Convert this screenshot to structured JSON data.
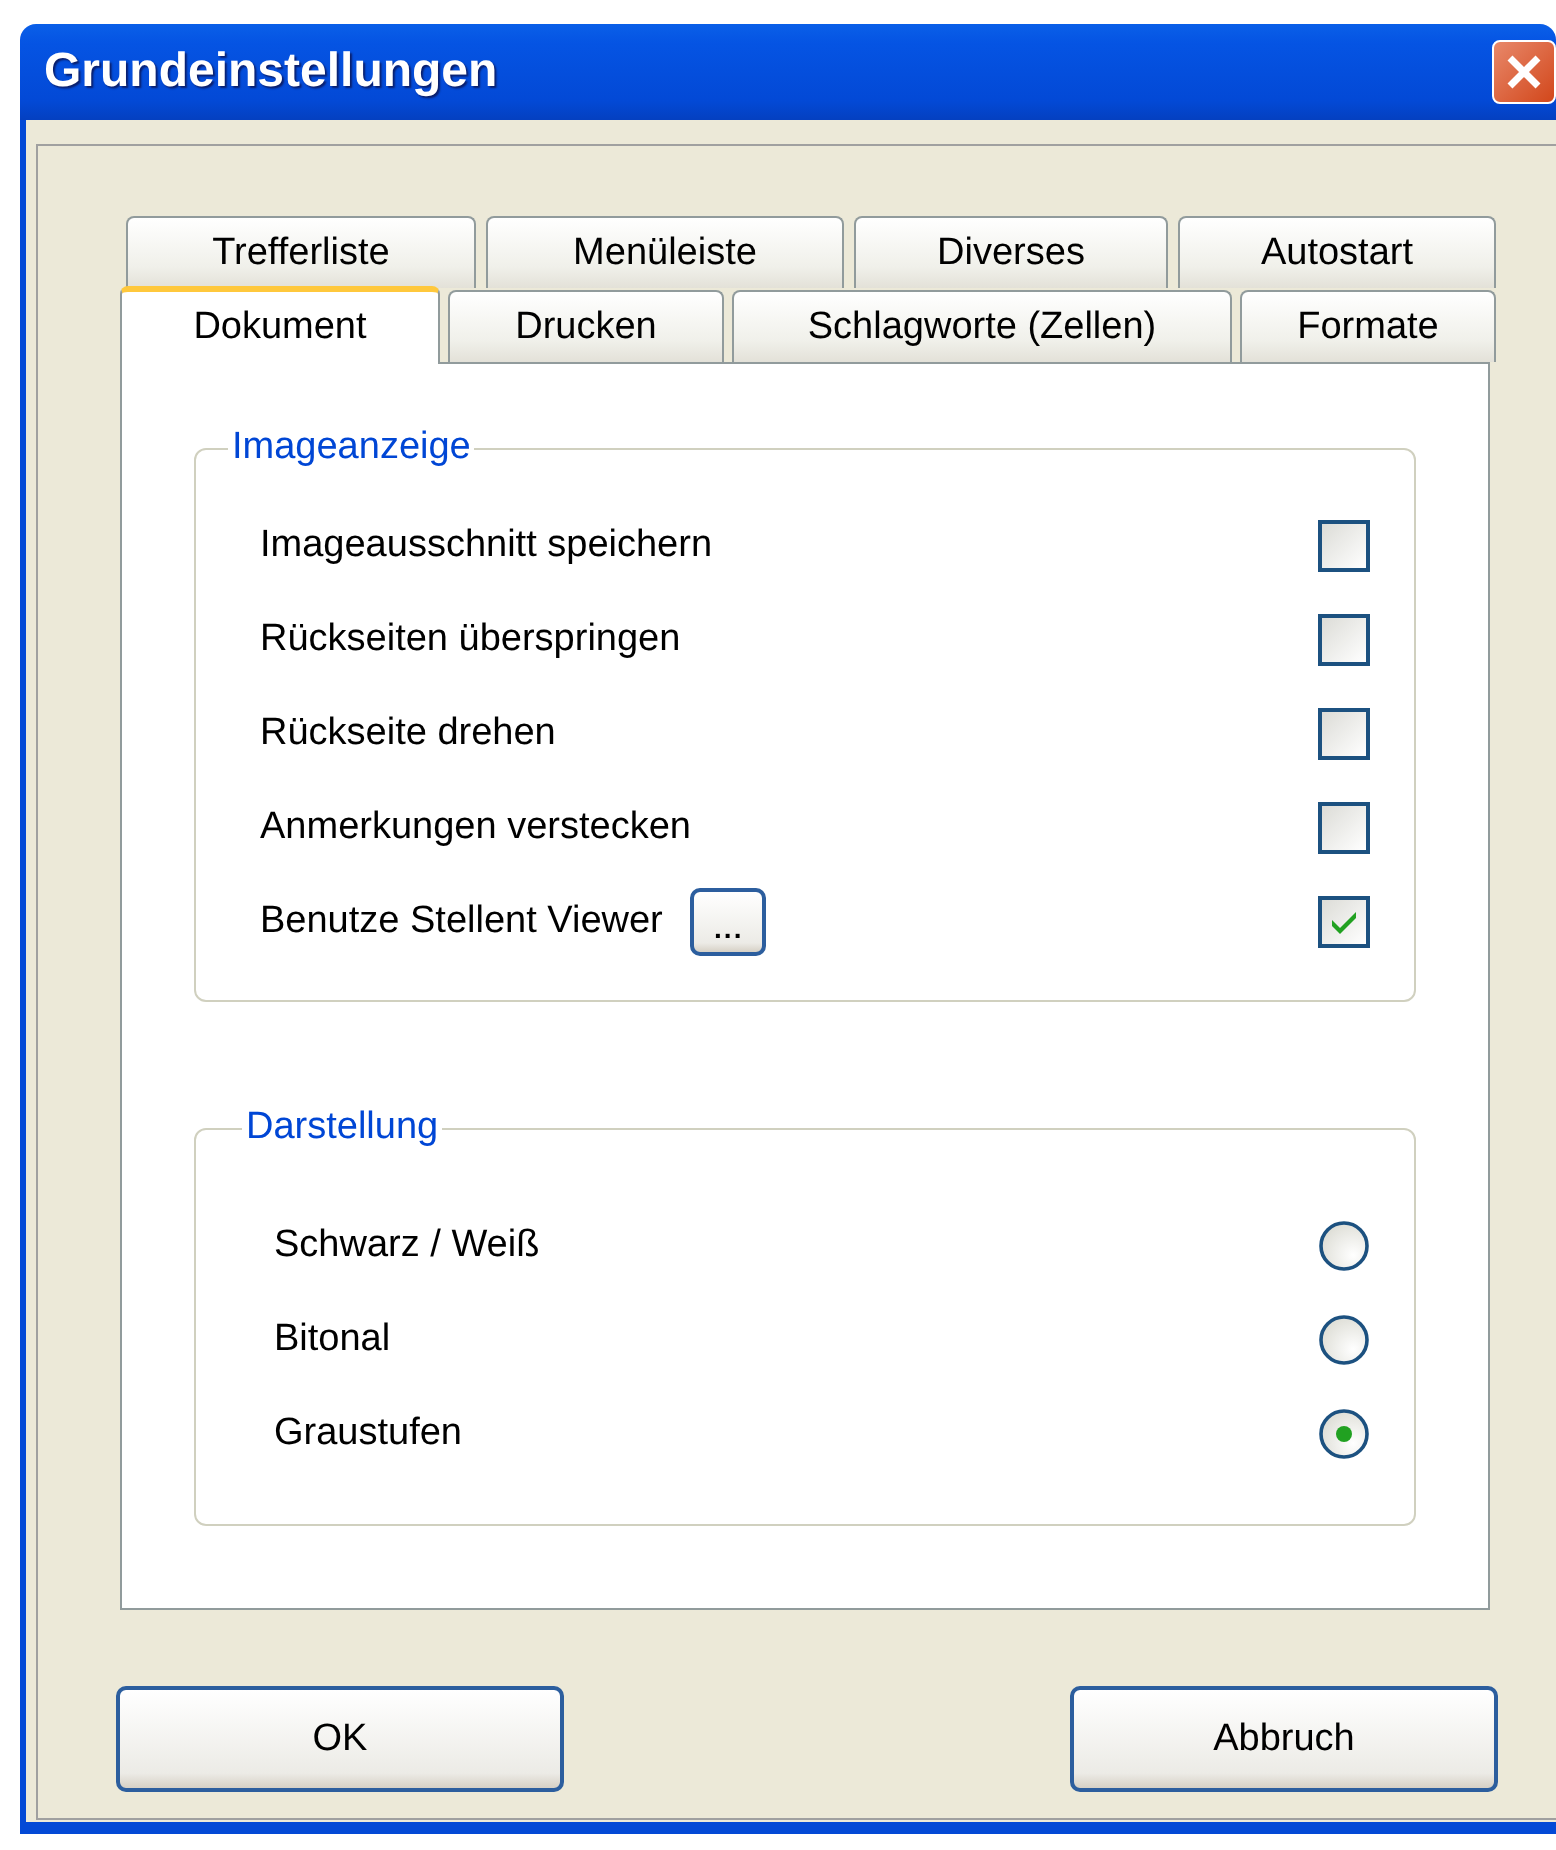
{
  "window": {
    "title": "Grundeinstellungen"
  },
  "tab_rows": [
    [
      {
        "label": "Trefferliste",
        "selected": false
      },
      {
        "label": "Menüleiste",
        "selected": false
      },
      {
        "label": "Diverses",
        "selected": false
      },
      {
        "label": "Autostart",
        "selected": false
      }
    ],
    [
      {
        "label": "Dokument",
        "selected": true
      },
      {
        "label": "Drucken",
        "selected": false
      },
      {
        "label": "Schlagworte (Zellen)",
        "selected": false
      },
      {
        "label": "Formate",
        "selected": false
      }
    ]
  ],
  "imageanzeige": {
    "title": "Imageanzeige",
    "options": [
      {
        "label": "Imageausschnitt speichern",
        "checked": false
      },
      {
        "label": "Rückseiten überspringen",
        "checked": false
      },
      {
        "label": "Rückseite drehen",
        "checked": false
      },
      {
        "label": "Anmerkungen verstecken",
        "checked": false
      },
      {
        "label": "Benutze Stellent Viewer",
        "checked": true,
        "button": "..."
      }
    ]
  },
  "darstellung": {
    "title": "Darstellung",
    "options": [
      {
        "label": "Schwarz / Weiß",
        "selected": false
      },
      {
        "label": "Bitonal",
        "selected": false
      },
      {
        "label": "Graustufen",
        "selected": true
      }
    ]
  },
  "buttons": [
    "OK",
    "Abbruch"
  ]
}
